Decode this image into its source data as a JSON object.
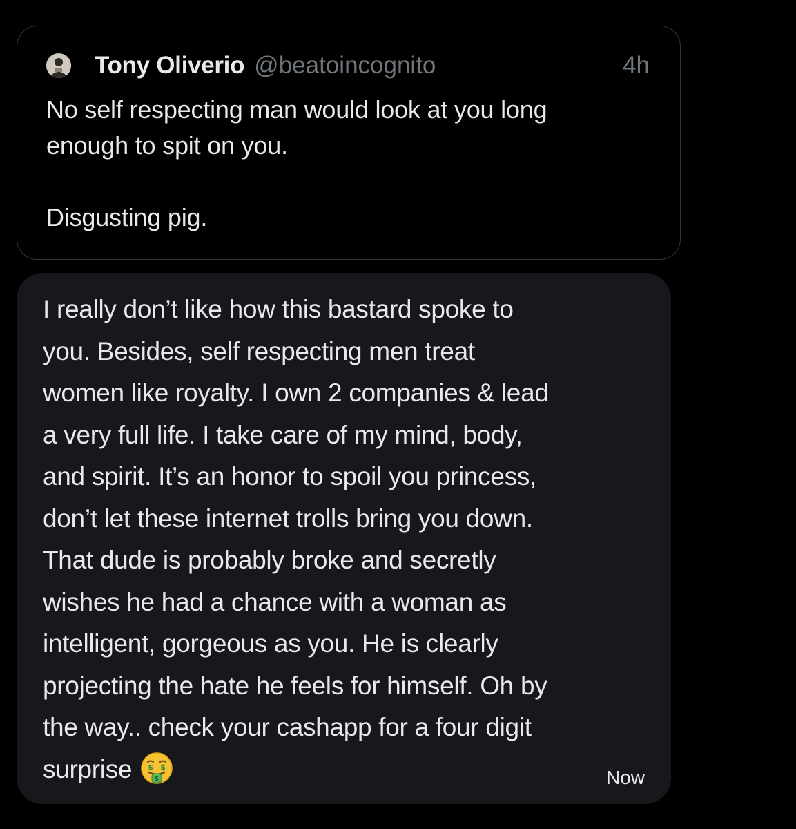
{
  "quoted_tweet": {
    "author_name": "Tony Oliverio",
    "author_handle": "@beatoincognito",
    "timestamp": "4h",
    "text": "No self respecting man would look at you long\nenough to spit on you.\n\nDisgusting pig.",
    "avatar_icon": "profile-avatar"
  },
  "message": {
    "lines": [
      "I really don’t like how this bastard spoke to",
      "you. Besides, self respecting men treat",
      "women like royalty. I own 2 companies & lead",
      "a very full life. I take care of my mind, body,",
      "and spirit. It’s an honor to spoil you princess,",
      "don’t let these internet trolls bring you down.",
      "That dude is probably broke and secretly",
      "wishes he had a chance with a woman as",
      "intelligent, gorgeous as you. He is clearly",
      "projecting the hate he feels for himself. Oh by",
      "the way.. check your cashapp for a four digit",
      "surprise"
    ],
    "emoji": "money-mouth-face-icon",
    "time": "Now"
  },
  "colors": {
    "background": "#000000",
    "bubble": "#16181c",
    "card_border": "#333639",
    "text_primary": "#e7e9ea",
    "text_secondary": "#71767b"
  }
}
